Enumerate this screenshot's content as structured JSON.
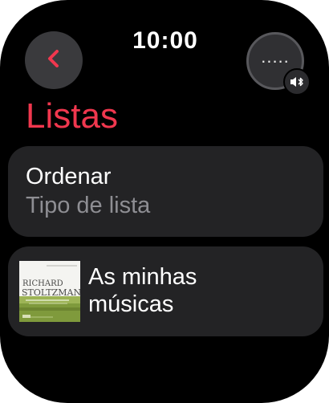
{
  "status_bar": {
    "time": "10:00"
  },
  "header": {
    "back_icon": "chevron-left-icon",
    "more_label": ".....",
    "more_icon": "ellipsis-icon",
    "audio_output_icon": "speaker-bluetooth-icon"
  },
  "page": {
    "title": "Listas"
  },
  "rows": {
    "sort": {
      "title": "Ordenar",
      "subtitle": "Tipo de lista"
    },
    "library": {
      "line1": "As minhas",
      "line2": "músicas",
      "artwork_text": "RICHARD STOLTZMAN"
    }
  },
  "colors": {
    "accent": "#f0374e",
    "background": "#000000",
    "row_background": "#232325",
    "secondary_text": "#8e8e93"
  }
}
